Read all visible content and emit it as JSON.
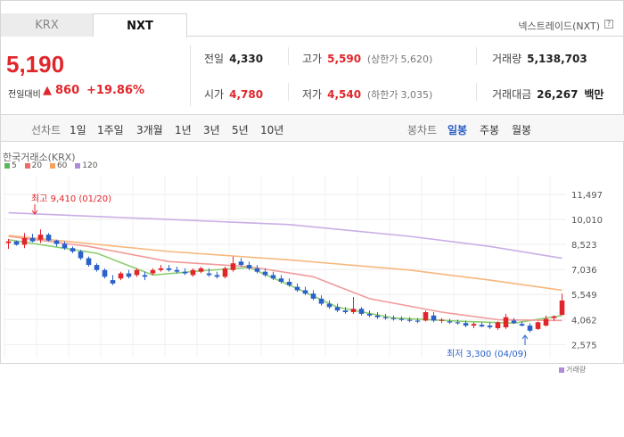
{
  "tabs": [
    {
      "label": "KRX"
    },
    {
      "label": "NXT"
    }
  ],
  "source_label": "넥스트레이드(NXT)",
  "help_icon": "?",
  "price": {
    "current": "5,190",
    "change_label": "전일대비",
    "change_arrow": "▲",
    "change_value": "860",
    "change_rate": "+19.86%"
  },
  "stats": {
    "prev_label": "전일",
    "prev_value": "4,330",
    "high_label": "고가",
    "high_value": "5,590",
    "upper_limit_label": "(상한가",
    "upper_limit_value": "5,620)",
    "volume_label": "거래량",
    "volume_value": "5,138,703",
    "open_label": "시가",
    "open_value": "4,780",
    "low_label": "저가",
    "low_value": "4,540",
    "lower_limit_label": "(하한가",
    "lower_limit_value": "3,035)",
    "amount_label": "거래대금",
    "amount_value": "26,267",
    "amount_unit": "백만"
  },
  "toolbar": {
    "line_chart": "선차트",
    "periods": [
      "1일",
      "1주일",
      "3개월",
      "1년",
      "3년",
      "5년",
      "10년"
    ],
    "candle_chart": "봉차트",
    "candle_periods": [
      "일봉",
      "주봉",
      "월봉"
    ]
  },
  "chart": {
    "source_title": "한국거래소(KRX)",
    "legend": [
      {
        "label": "5",
        "color": "#5bb75b"
      },
      {
        "label": "20",
        "color": "#f06a6a"
      },
      {
        "label": "60",
        "color": "#f5a35c"
      },
      {
        "label": "120",
        "color": "#b08ad8"
      }
    ],
    "high_annotation": "최고 9,410 (01/20)",
    "low_annotation": "최저 3,300 (04/09)",
    "footer_label": "거래량"
  },
  "chart_data": {
    "type": "candlestick",
    "y_ticks": [
      11497,
      10010,
      8523,
      7036,
      5549,
      4062,
      2575
    ],
    "ylim": [
      1800,
      12600
    ],
    "up_color": "#e0262b",
    "down_color": "#2a62c9",
    "candles": [
      [
        8600,
        8850,
        8250,
        8700
      ],
      [
        8700,
        8750,
        8450,
        8500
      ],
      [
        8500,
        9200,
        8300,
        8900
      ],
      [
        8900,
        9150,
        8650,
        8700
      ],
      [
        8800,
        9410,
        8600,
        9100
      ],
      [
        9100,
        9200,
        8700,
        8750
      ],
      [
        8750,
        8800,
        8400,
        8550
      ],
      [
        8550,
        8700,
        8200,
        8300
      ],
      [
        8300,
        8400,
        8000,
        8100
      ],
      [
        8100,
        8200,
        7600,
        7700
      ],
      [
        7700,
        7800,
        7200,
        7300
      ],
      [
        7300,
        7400,
        6900,
        7000
      ],
      [
        7000,
        7100,
        6500,
        6600
      ],
      [
        6400,
        6700,
        6100,
        6200
      ],
      [
        6500,
        6900,
        6400,
        6800
      ],
      [
        6800,
        7000,
        6500,
        6600
      ],
      [
        6700,
        7100,
        6600,
        7000
      ],
      [
        6700,
        6900,
        6400,
        6600
      ],
      [
        6800,
        7100,
        6700,
        7000
      ],
      [
        7000,
        7300,
        6900,
        7100
      ],
      [
        7100,
        7300,
        6900,
        7000
      ],
      [
        7000,
        7200,
        6800,
        6900
      ],
      [
        6900,
        7100,
        6700,
        6800
      ],
      [
        6700,
        7100,
        6600,
        7000
      ],
      [
        6900,
        7200,
        6800,
        7100
      ],
      [
        6800,
        7100,
        6600,
        6700
      ],
      [
        6700,
        6900,
        6500,
        6600
      ],
      [
        6600,
        7200,
        6500,
        7100
      ],
      [
        7000,
        7800,
        6900,
        7400
      ],
      [
        7500,
        7700,
        7200,
        7300
      ],
      [
        7300,
        7500,
        7000,
        7100
      ],
      [
        7100,
        7300,
        6800,
        6900
      ],
      [
        6900,
        7100,
        6600,
        6700
      ],
      [
        6700,
        6900,
        6400,
        6500
      ],
      [
        6500,
        6700,
        6200,
        6300
      ],
      [
        6300,
        6500,
        6000,
        6100
      ],
      [
        6000,
        6200,
        5700,
        5800
      ],
      [
        5800,
        6000,
        5500,
        5600
      ],
      [
        5600,
        5800,
        5200,
        5300
      ],
      [
        5300,
        5500,
        4900,
        5000
      ],
      [
        5000,
        5200,
        4700,
        4800
      ],
      [
        4800,
        5000,
        4500,
        4600
      ],
      [
        4600,
        4800,
        4400,
        4500
      ],
      [
        4500,
        5400,
        4400,
        4700
      ],
      [
        4700,
        4800,
        4300,
        4400
      ],
      [
        4400,
        4600,
        4200,
        4300
      ],
      [
        4300,
        4500,
        4100,
        4200
      ],
      [
        4200,
        4400,
        4050,
        4150
      ],
      [
        4150,
        4300,
        4000,
        4100
      ],
      [
        4100,
        4250,
        3950,
        4050
      ],
      [
        4050,
        4200,
        3900,
        4000
      ],
      [
        4000,
        4150,
        3850,
        3950
      ],
      [
        4000,
        4600,
        3950,
        4500
      ],
      [
        4300,
        4500,
        3900,
        4000
      ],
      [
        4000,
        4150,
        3850,
        4050
      ],
      [
        3950,
        4100,
        3800,
        3900
      ],
      [
        3900,
        4050,
        3750,
        3850
      ],
      [
        3850,
        4000,
        3600,
        3700
      ],
      [
        3700,
        3900,
        3550,
        3800
      ],
      [
        3750,
        3900,
        3600,
        3650
      ],
      [
        3700,
        3900,
        3500,
        3600
      ],
      [
        3550,
        3950,
        3450,
        3900
      ],
      [
        3600,
        4400,
        3500,
        4200
      ],
      [
        4000,
        4150,
        3800,
        3850
      ],
      [
        3800,
        3950,
        3650,
        3700
      ],
      [
        3700,
        3850,
        3300,
        3400
      ],
      [
        3500,
        3950,
        3450,
        3900
      ],
      [
        3700,
        4300,
        3650,
        4100
      ],
      [
        4150,
        4300,
        4000,
        4250
      ],
      [
        4330,
        5590,
        4540,
        5190
      ]
    ],
    "ma": {
      "ma5": [
        [
          0,
          8800
        ],
        [
          11,
          8000
        ],
        [
          18,
          6700
        ],
        [
          24,
          6950
        ],
        [
          30,
          7150
        ],
        [
          36,
          5900
        ],
        [
          41,
          4800
        ],
        [
          48,
          4150
        ],
        [
          57,
          3950
        ],
        [
          63,
          3850
        ],
        [
          69,
          4300
        ]
      ],
      "ma20": [
        [
          0,
          9000
        ],
        [
          10,
          8400
        ],
        [
          20,
          7500
        ],
        [
          30,
          7200
        ],
        [
          38,
          6600
        ],
        [
          45,
          5300
        ],
        [
          54,
          4500
        ],
        [
          61,
          4050
        ],
        [
          69,
          4000
        ]
      ],
      "ma60": [
        [
          0,
          9050
        ],
        [
          20,
          8100
        ],
        [
          35,
          7600
        ],
        [
          50,
          7000
        ],
        [
          60,
          6400
        ],
        [
          69,
          5800
        ]
      ],
      "ma120": [
        [
          0,
          10400
        ],
        [
          20,
          10000
        ],
        [
          35,
          9700
        ],
        [
          50,
          9000
        ],
        [
          60,
          8400
        ],
        [
          69,
          7700
        ]
      ]
    }
  }
}
